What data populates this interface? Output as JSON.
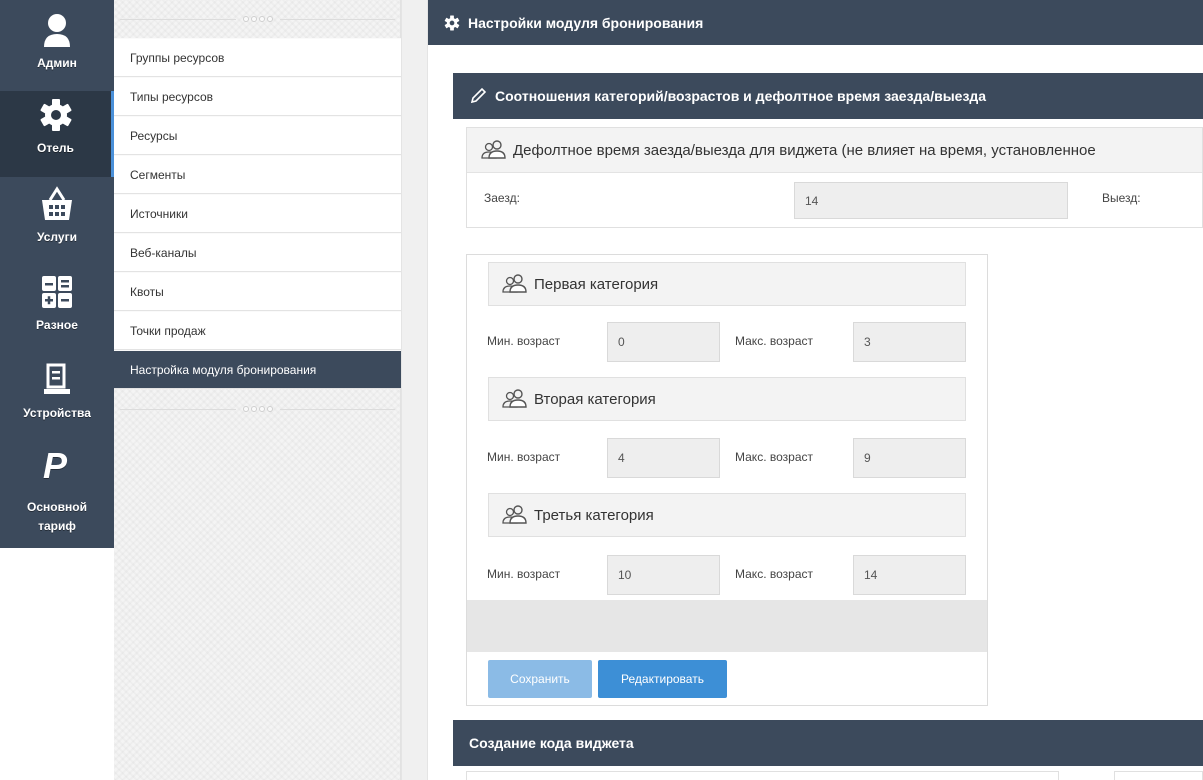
{
  "rail": {
    "items": [
      {
        "label": "Админ",
        "icon": "user-icon"
      },
      {
        "label": "Отель",
        "icon": "gear-icon"
      },
      {
        "label": "Услуги",
        "icon": "basket-icon"
      },
      {
        "label": "Разное",
        "icon": "calculator-icon"
      },
      {
        "label": "Устройства",
        "icon": "printer-icon"
      },
      {
        "label": "Основной тариф",
        "icon": "paypal-icon"
      }
    ]
  },
  "submenu": {
    "items": [
      "Группы ресурсов",
      "Типы ресурсов",
      "Ресурсы",
      "Сегменты",
      "Источники",
      "Веб-каналы",
      "Квоты",
      "Точки продаж",
      "Настройка модуля бронирования"
    ]
  },
  "topbar": {
    "title": "Настройки модуля бронирования"
  },
  "panel": {
    "title": "Соотношения категорий/возрастов и дефолтное время заезда/выезда",
    "default_time_title": "Дефолтное время заезда/выезда для виджета (не влияет на время, установленное",
    "checkin_label": "Заезд:",
    "checkin_value": "14",
    "checkout_label": "Выезд:"
  },
  "categories": [
    {
      "title": "Первая категория",
      "min_label": "Мин. возраст",
      "min_value": "0",
      "max_label": "Макс. возраст",
      "max_value": "3"
    },
    {
      "title": "Вторая категория",
      "min_label": "Мин. возраст",
      "min_value": "4",
      "max_label": "Макс. возраст",
      "max_value": "9"
    },
    {
      "title": "Третья категория",
      "min_label": "Мин. возраст",
      "min_value": "10",
      "max_label": "Макс. возраст",
      "max_value": "14"
    }
  ],
  "buttons": {
    "save": "Сохранить",
    "edit": "Редактировать"
  },
  "widget_panel": {
    "title": "Создание кода виджета"
  },
  "colors": {
    "navy": "#3c4a5c",
    "accent_blue": "#3d8fd6",
    "disabled_blue": "#8bbbe6"
  }
}
